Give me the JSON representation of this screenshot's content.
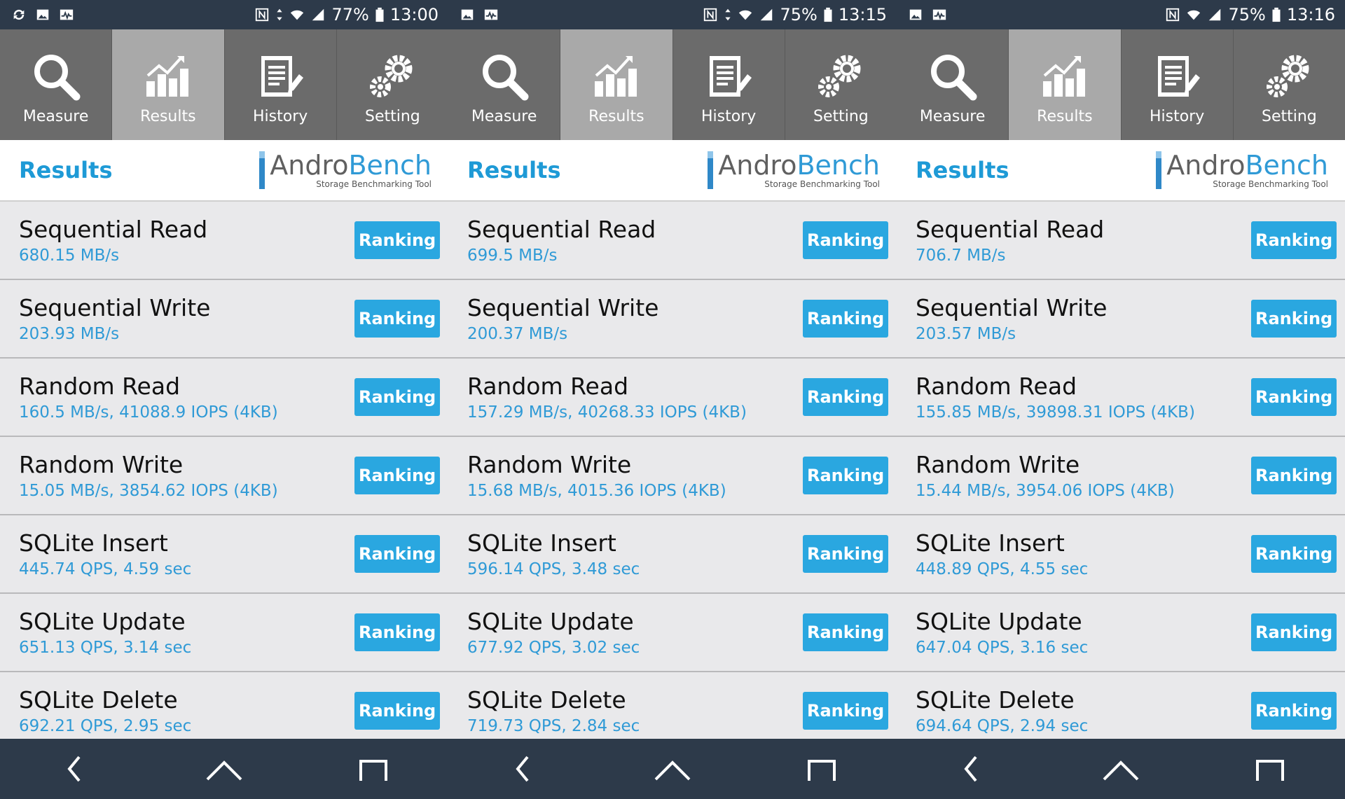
{
  "panels": [
    {
      "status": {
        "battery": "77%",
        "time": "13:00"
      },
      "tabs": [
        {
          "label": "Measure"
        },
        {
          "label": "Results"
        },
        {
          "label": "History"
        },
        {
          "label": "Setting"
        }
      ],
      "header": {
        "title": "Results"
      },
      "logo": {
        "name_part1": "Andro",
        "name_part2": "Bench",
        "subtitle": "Storage Benchmarking Tool"
      },
      "rows": [
        {
          "name": "Sequential Read",
          "value": "680.15 MB/s",
          "button": "Ranking"
        },
        {
          "name": "Sequential Write",
          "value": "203.93 MB/s",
          "button": "Ranking"
        },
        {
          "name": "Random Read",
          "value": "160.5 MB/s, 41088.9 IOPS (4KB)",
          "button": "Ranking"
        },
        {
          "name": "Random Write",
          "value": "15.05 MB/s, 3854.62 IOPS (4KB)",
          "button": "Ranking"
        },
        {
          "name": "SQLite Insert",
          "value": "445.74 QPS, 4.59 sec",
          "button": "Ranking"
        },
        {
          "name": "SQLite Update",
          "value": "651.13 QPS, 3.14 sec",
          "button": "Ranking"
        },
        {
          "name": "SQLite Delete",
          "value": "692.21 QPS, 2.95 sec",
          "button": "Ranking"
        }
      ]
    },
    {
      "status": {
        "battery": "75%",
        "time": "13:15"
      },
      "tabs": [
        {
          "label": "Measure"
        },
        {
          "label": "Results"
        },
        {
          "label": "History"
        },
        {
          "label": "Setting"
        }
      ],
      "header": {
        "title": "Results"
      },
      "logo": {
        "name_part1": "Andro",
        "name_part2": "Bench",
        "subtitle": "Storage Benchmarking Tool"
      },
      "rows": [
        {
          "name": "Sequential Read",
          "value": "699.5 MB/s",
          "button": "Ranking"
        },
        {
          "name": "Sequential Write",
          "value": "200.37 MB/s",
          "button": "Ranking"
        },
        {
          "name": "Random Read",
          "value": "157.29 MB/s, 40268.33 IOPS (4KB)",
          "button": "Ranking"
        },
        {
          "name": "Random Write",
          "value": "15.68 MB/s, 4015.36 IOPS (4KB)",
          "button": "Ranking"
        },
        {
          "name": "SQLite Insert",
          "value": "596.14 QPS, 3.48 sec",
          "button": "Ranking"
        },
        {
          "name": "SQLite Update",
          "value": "677.92 QPS, 3.02 sec",
          "button": "Ranking"
        },
        {
          "name": "SQLite Delete",
          "value": "719.73 QPS, 2.84 sec",
          "button": "Ranking"
        }
      ]
    },
    {
      "status": {
        "battery": "75%",
        "time": "13:16"
      },
      "tabs": [
        {
          "label": "Measure"
        },
        {
          "label": "Results"
        },
        {
          "label": "History"
        },
        {
          "label": "Setting"
        }
      ],
      "header": {
        "title": "Results"
      },
      "logo": {
        "name_part1": "Andro",
        "name_part2": "Bench",
        "subtitle": "Storage Benchmarking Tool"
      },
      "rows": [
        {
          "name": "Sequential Read",
          "value": "706.7 MB/s",
          "button": "Ranking"
        },
        {
          "name": "Sequential Write",
          "value": "203.57 MB/s",
          "button": "Ranking"
        },
        {
          "name": "Random Read",
          "value": "155.85 MB/s, 39898.31 IOPS (4KB)",
          "button": "Ranking"
        },
        {
          "name": "Random Write",
          "value": "15.44 MB/s, 3954.06 IOPS (4KB)",
          "button": "Ranking"
        },
        {
          "name": "SQLite Insert",
          "value": "448.89 QPS, 4.55 sec",
          "button": "Ranking"
        },
        {
          "name": "SQLite Update",
          "value": "647.04 QPS, 3.16 sec",
          "button": "Ranking"
        },
        {
          "name": "SQLite Delete",
          "value": "694.64 QPS, 2.94 sec",
          "button": "Ranking"
        }
      ]
    }
  ]
}
